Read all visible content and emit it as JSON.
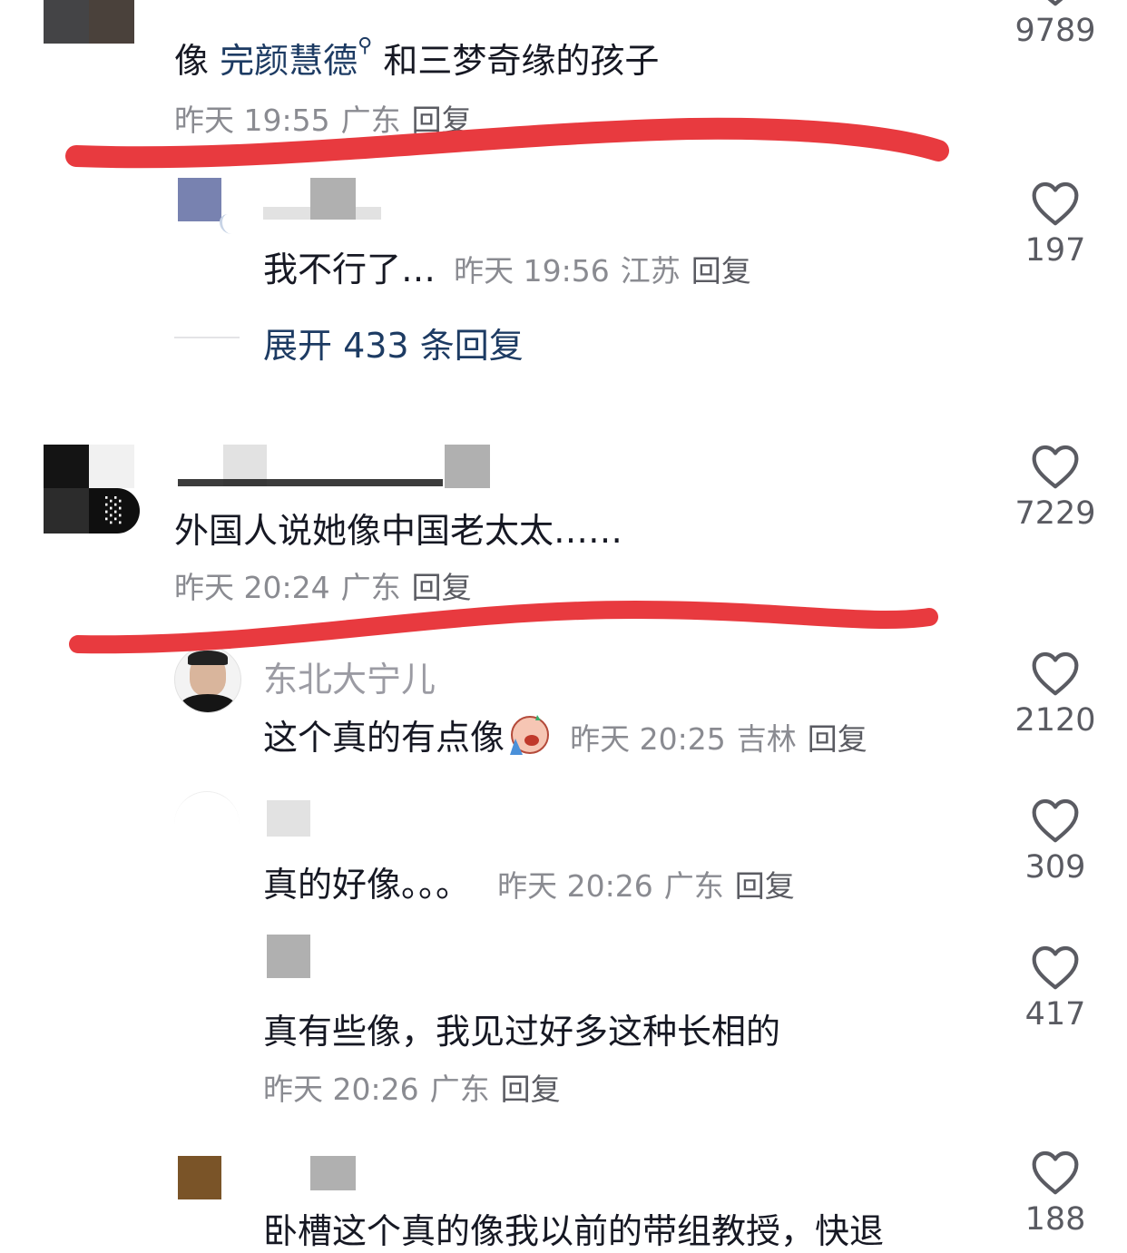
{
  "comments": [
    {
      "text_prefix": "像 ",
      "mention": "完颜慧德",
      "text_suffix": " 和三梦奇缘的孩子",
      "time": "昨天 19:55",
      "location": "广东",
      "reply_label": "回复",
      "likes": "9789"
    },
    {
      "text": "外国人说她像中国老太太……",
      "time": "昨天 20:24",
      "location": "广东",
      "reply_label": "回复",
      "likes": "7229"
    }
  ],
  "replies": [
    {
      "text": "我不行了…",
      "time": "昨天 19:56",
      "location": "江苏",
      "reply_label": "回复",
      "likes": "197"
    },
    {
      "username": "东北大宁儿",
      "text": "这个真的有点像",
      "emoji": "crying-emoji",
      "time": "昨天 20:25",
      "location": "吉林",
      "reply_label": "回复",
      "likes": "2120"
    },
    {
      "text": "真的好像。。。",
      "time": "昨天 20:26",
      "location": "广东",
      "reply_label": "回复",
      "likes": "309"
    },
    {
      "text": "真有些像，我见过好多这种长相的",
      "time": "昨天 20:26",
      "location": "广东",
      "reply_label": "回复",
      "likes": "417"
    },
    {
      "text": "卧槽这个真的像我以前的带组教授，快退",
      "likes": "188"
    }
  ],
  "expand_label": "展开 433 条回复",
  "colors": {
    "red_underline": "#e83a3f",
    "mention_link": "#1d3b63",
    "meta_gray": "#8a8b91"
  },
  "icons": {
    "like": "heart-outline-icon",
    "mention_search": "search-icon"
  }
}
